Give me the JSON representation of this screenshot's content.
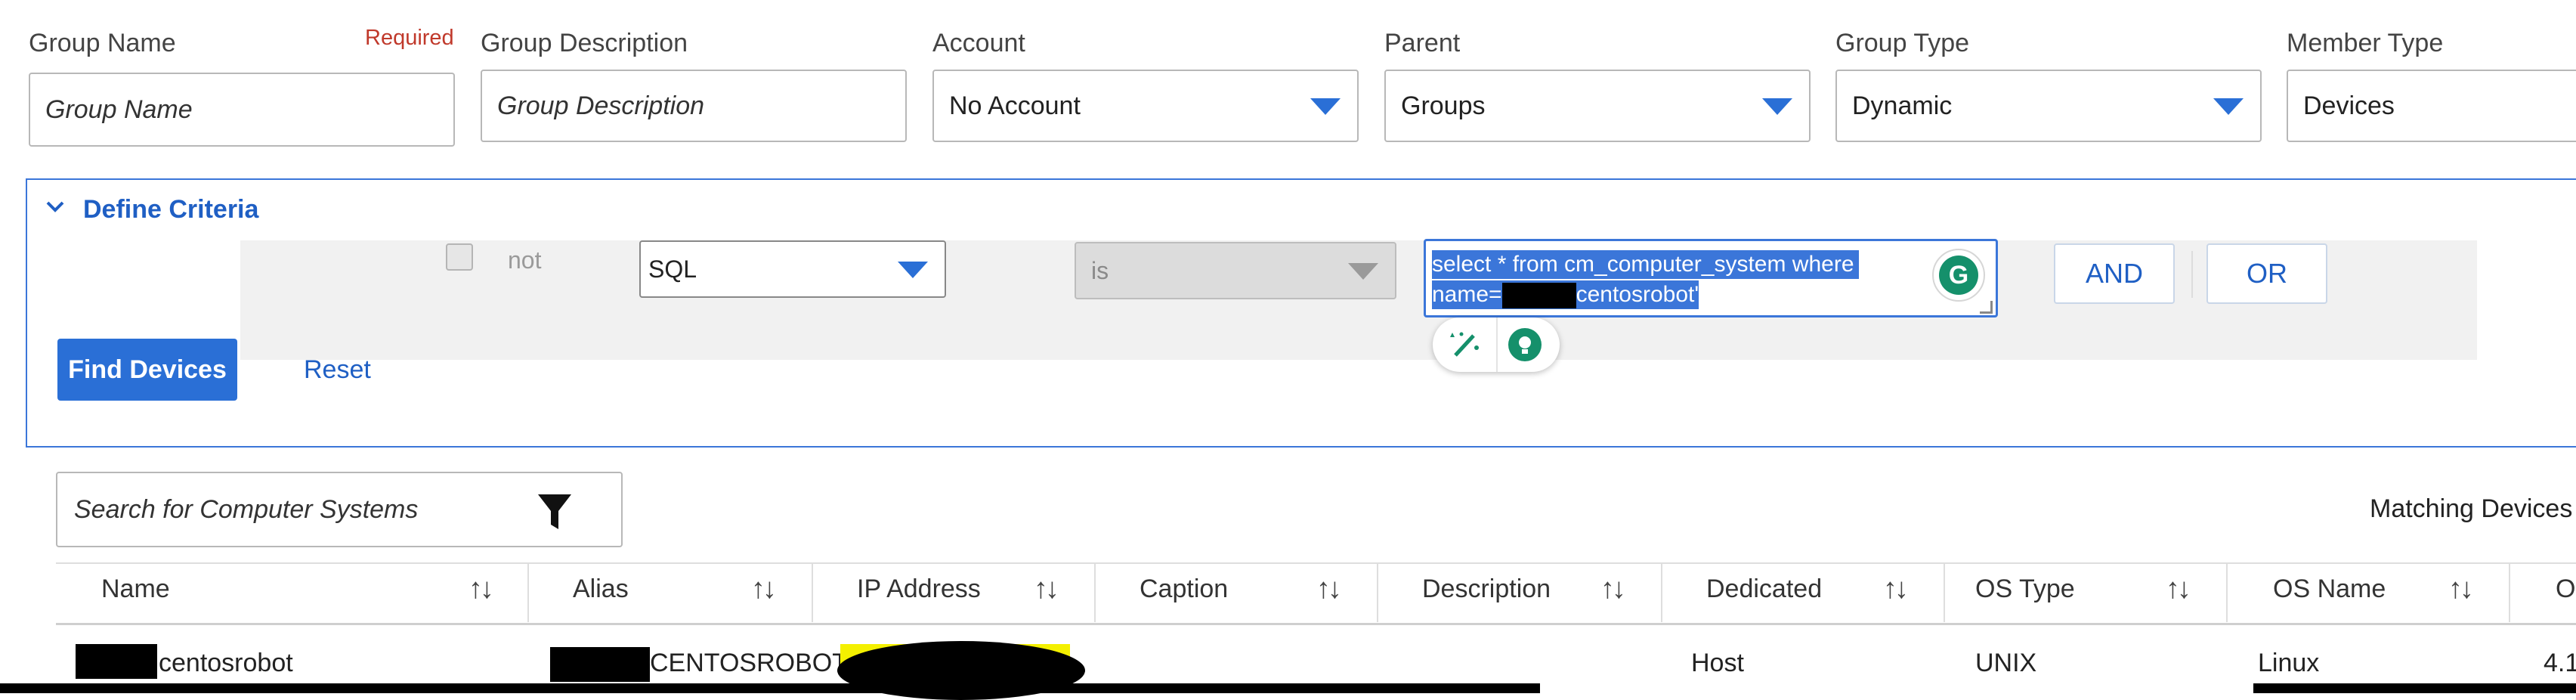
{
  "form": {
    "group_name": {
      "label": "Group Name",
      "required": "Required",
      "placeholder": "Group Name"
    },
    "group_description": {
      "label": "Group Description",
      "placeholder": "Group Description"
    },
    "account": {
      "label": "Account",
      "value": "No Account"
    },
    "parent": {
      "label": "Parent",
      "value": "Groups"
    },
    "group_type": {
      "label": "Group Type",
      "value": "Dynamic"
    },
    "member_type": {
      "label": "Member Type",
      "value": "Devices"
    }
  },
  "criteria": {
    "title": "Define Criteria",
    "not_label": "not",
    "field_select": "SQL",
    "operator_select": "is",
    "query_line1": "select * from cm_computer_system where",
    "query_line2_prefix": "name=",
    "query_line2_suffix": "centosrobot'",
    "and_label": "AND",
    "or_label": "OR",
    "find_label": "Find Devices",
    "reset_label": "Reset"
  },
  "results": {
    "search_placeholder": "Search for Computer Systems",
    "matching_label": "Matching Devices",
    "columns": [
      "Name",
      "Alias",
      "IP Address",
      "Caption",
      "Description",
      "Dedicated",
      "OS Type",
      "OS Name",
      "O"
    ],
    "row": {
      "name": "centosrobot",
      "alias": "CENTOSROBOT",
      "dedicated": "Host",
      "os_type": "UNIX",
      "os_name": "Linux",
      "os_version": "4.1"
    }
  },
  "colors": {
    "accent": "#2a6fd6",
    "required": "#c0392b",
    "selection": "#3b76d9"
  }
}
